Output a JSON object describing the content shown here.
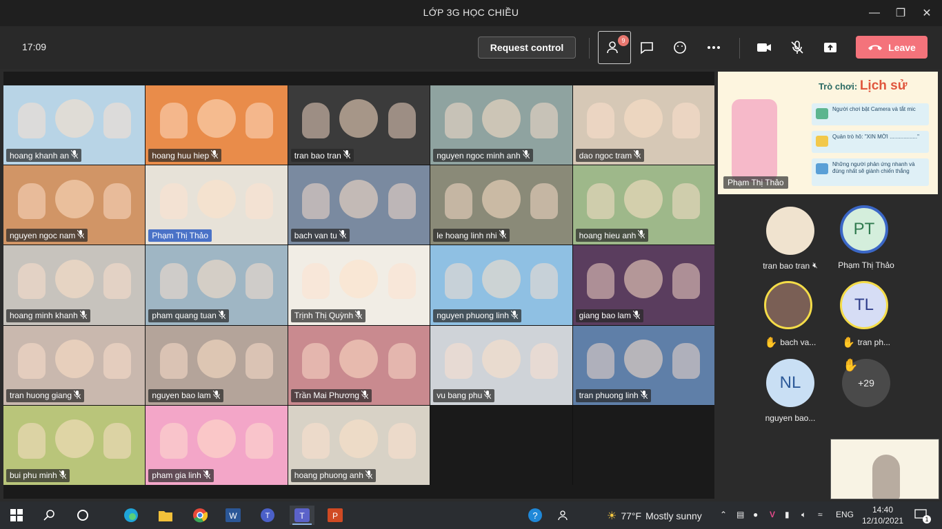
{
  "window": {
    "title": "LỚP 3G HỌC CHIỀU"
  },
  "toolbar": {
    "time": "17:09",
    "request_control": "Request control",
    "participants_count": "9",
    "leave": "Leave"
  },
  "tiles": [
    {
      "name": "hoang khanh an",
      "bg": "#b8d4e6",
      "hl": false
    },
    {
      "name": "hoang huu hiep",
      "bg": "#e98c4a",
      "hl": false
    },
    {
      "name": "tran bao tran",
      "bg": "#3b3b3b",
      "hl": false
    },
    {
      "name": "nguyen ngoc minh anh",
      "bg": "#8fa3a0",
      "hl": false
    },
    {
      "name": "dao ngoc tram",
      "bg": "#d6c8b6",
      "hl": false
    },
    {
      "name": "nguyen ngoc nam",
      "bg": "#d19566",
      "hl": false
    },
    {
      "name": "Phạm Thị Thảo",
      "bg": "#e7e2d8",
      "hl": true
    },
    {
      "name": "bach van tu",
      "bg": "#7a8aa0",
      "hl": false
    },
    {
      "name": "le hoang linh nhi",
      "bg": "#8a8a78",
      "hl": false
    },
    {
      "name": "hoang hieu anh",
      "bg": "#9eb88a",
      "hl": false
    },
    {
      "name": "hoang minh khanh",
      "bg": "#c7c3bd",
      "hl": false
    },
    {
      "name": "pham quang tuan",
      "bg": "#9fb6c4",
      "hl": false
    },
    {
      "name": "Trịnh Thị Quỳnh",
      "bg": "#f1ede5",
      "hl": false
    },
    {
      "name": "nguyen phuong linh",
      "bg": "#8fc0e3",
      "hl": false
    },
    {
      "name": "giang bao lam",
      "bg": "#5a3d5e",
      "hl": false
    },
    {
      "name": "tran huong giang",
      "bg": "#c9b8ae",
      "hl": false
    },
    {
      "name": "nguyen bao lam",
      "bg": "#b4a49a",
      "hl": false
    },
    {
      "name": "Trần Mai Phương",
      "bg": "#c98a8f",
      "hl": false
    },
    {
      "name": "vu bang phu",
      "bg": "#cfd3d8",
      "hl": false
    },
    {
      "name": "tran phuong linh",
      "bg": "#5f7fa8",
      "hl": false
    },
    {
      "name": "bui phu minh",
      "bg": "#b9c57a",
      "hl": false
    },
    {
      "name": "pham gia linh",
      "bg": "#f3a6c8",
      "hl": false
    },
    {
      "name": "hoang phuong anh",
      "bg": "#d8d2c6",
      "hl": false
    },
    {
      "name": "",
      "bg": "#1a1a1a",
      "hl": false
    },
    {
      "name": "",
      "bg": "#1a1a1a",
      "hl": false
    }
  ],
  "share": {
    "game_label": "Trò chơi:",
    "game_topic": "Lịch sử",
    "rule1": "Người chơi bật Camera và tắt mic",
    "rule2": "Quản trò hô: \"XIN MỜI ..................\"",
    "rule3": "Những người phản ứng nhanh và đúng nhất sẽ giành chiến thắng",
    "presenter": "Phạm Thị Thảo"
  },
  "roster": [
    {
      "name": "tran bao tran",
      "initials": "",
      "raised": false
    },
    {
      "name": "Phạm Thị Thảo",
      "initials": "PT",
      "raised": false
    },
    {
      "name": "bach va...",
      "initials": "",
      "raised": true
    },
    {
      "name": "tran ph...",
      "initials": "TL",
      "raised": true
    },
    {
      "name": "nguyen bao...",
      "initials": "NL",
      "raised": false
    },
    {
      "name": "",
      "initials": "+29",
      "raised": true
    }
  ],
  "taskbar": {
    "weather_temp": "77°F",
    "weather_text": "Mostly sunny",
    "lang": "ENG",
    "time": "14:40",
    "date": "12/10/2021",
    "notifications": "1"
  }
}
